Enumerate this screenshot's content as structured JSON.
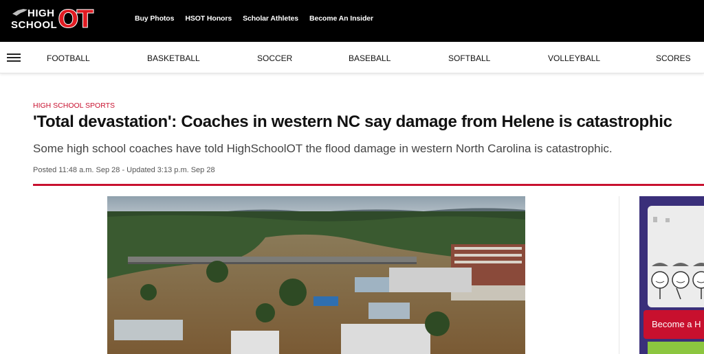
{
  "header": {
    "logo_text_line1": "HIGH",
    "logo_text_line2": "SCHOOL",
    "logo_ot": "OT",
    "links": [
      "Buy Photos",
      "HSOT Honors",
      "Scholar Athletes",
      "Become An Insider"
    ]
  },
  "sport_nav": {
    "menu_icon": "hamburger-menu-icon",
    "items": [
      "FOOTBALL",
      "BASKETBALL",
      "SOCCER",
      "BASEBALL",
      "SOFTBALL",
      "VOLLEYBALL",
      "SCORES"
    ]
  },
  "article": {
    "kicker": "HIGH SCHOOL SPORTS",
    "headline": "'Total devastation': Coaches in western NC say damage from Helene is catastrophic",
    "summary": "Some high school coaches have told HighSchoolOT the flood damage in western North Carolina is catastrophic.",
    "dateline": "Posted 11:48 a.m. Sep 28 - Updated 3:13 p.m. Sep 28"
  },
  "ad": {
    "cta_label": "Become a H"
  },
  "colors": {
    "brand_red": "#c8102e",
    "header_bg": "#000000",
    "ad_bg": "#3a2f7a"
  }
}
